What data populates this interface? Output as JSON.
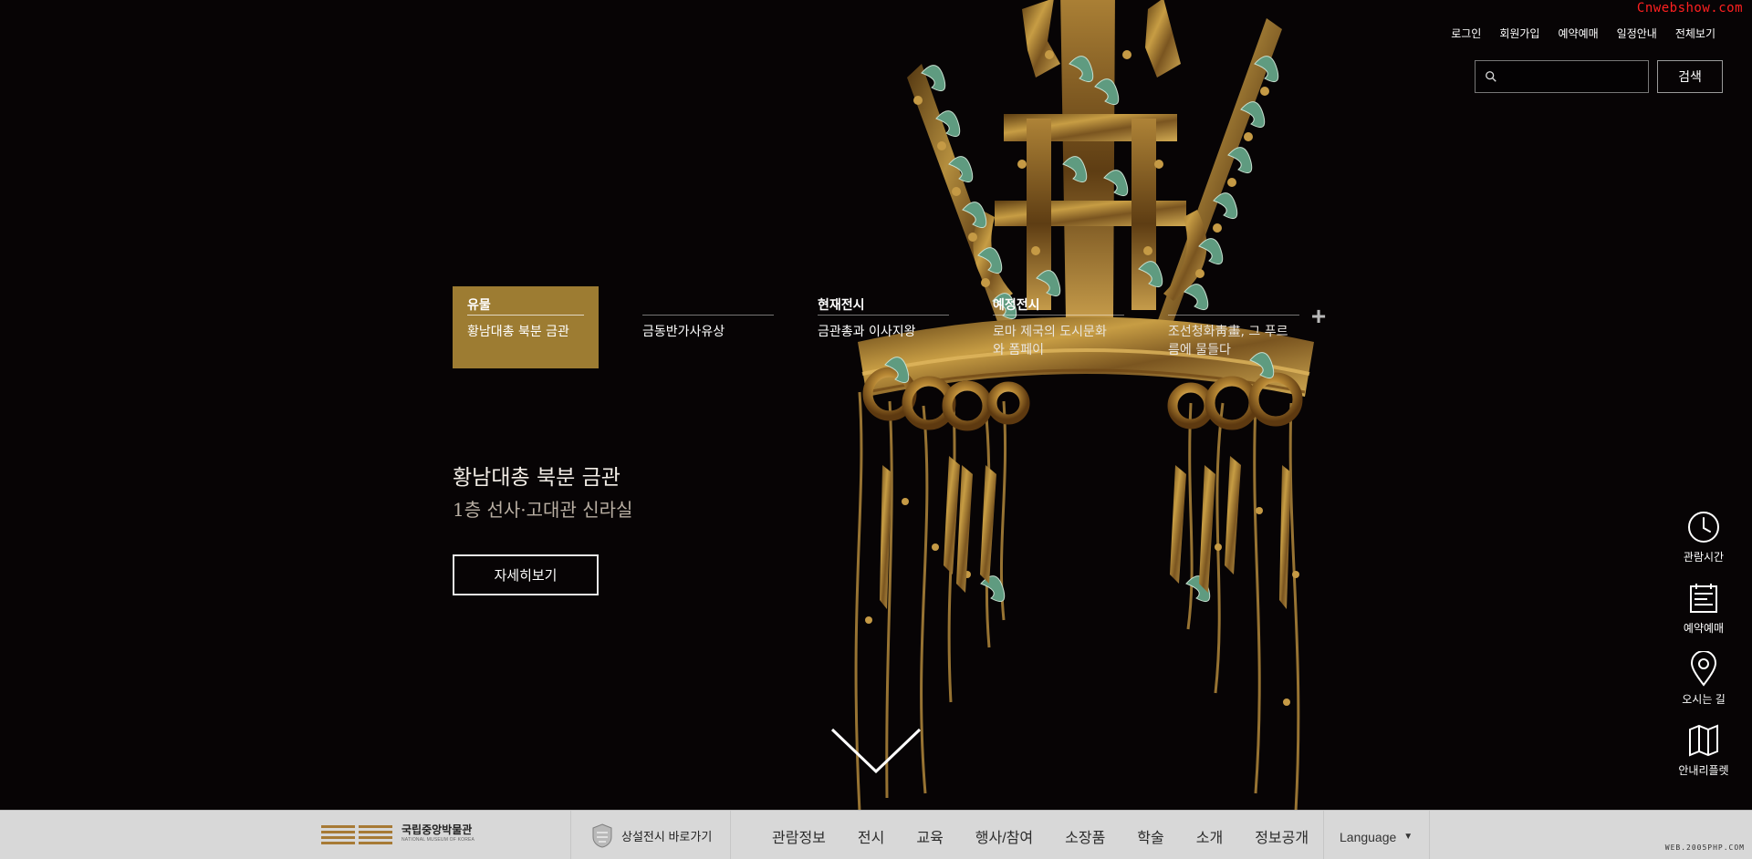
{
  "watermarks": {
    "top": "Cnwebshow.com",
    "bottom": "WEB.2005PHP.COM"
  },
  "util_nav": [
    {
      "label": "로그인"
    },
    {
      "label": "회원가입"
    },
    {
      "label": "예약예매"
    },
    {
      "label": "일정안내"
    },
    {
      "label": "전체보기"
    }
  ],
  "search": {
    "value": "",
    "placeholder": "",
    "button_label": "검색",
    "icon": "search-icon"
  },
  "tabs": [
    {
      "category": "유물",
      "title": "황남대총 북분 금관",
      "active": true
    },
    {
      "category": "",
      "title": "금동반가사유상",
      "active": false
    },
    {
      "category": "현재전시",
      "title": "금관총과 이사지왕",
      "active": false
    },
    {
      "category": "예정전시",
      "title": "로마 제국의 도시문화와 폼페이",
      "active": false
    },
    {
      "category": "",
      "title": "조선청화靑畫, 그 푸르름에 물들다",
      "active": false
    }
  ],
  "hero": {
    "title": "황남대총 북분 금관",
    "subtitle": "1층 선사·고대관 신라실",
    "detail_button": "자세히보기",
    "scroll_icon": "chevron-down-icon"
  },
  "quick_menu": [
    {
      "label": "관람시간",
      "icon": "clock-icon"
    },
    {
      "label": "예약예매",
      "icon": "calendar-icon"
    },
    {
      "label": "오시는 길",
      "icon": "map-pin-icon"
    },
    {
      "label": "안내리플렛",
      "icon": "map-leaflet-icon"
    }
  ],
  "footer": {
    "logo_text": "국립중앙박물관",
    "logo_subtitle": "NATIONAL MUSEUM OF KOREA",
    "permanent_link": "상설전시 바로가기",
    "menu": [
      "관람정보",
      "전시",
      "교육",
      "행사/참여",
      "소장품",
      "학술",
      "소개",
      "정보공개"
    ],
    "language": "Language",
    "language_icon": "chevron-down-icon"
  },
  "colors": {
    "background": "#070405",
    "active_tab": "#9d7c32",
    "footer_bg": "#d8d8d8",
    "gold": "#b8913d",
    "jade": "#5f9b80",
    "watermark_red": "#ff2020"
  }
}
